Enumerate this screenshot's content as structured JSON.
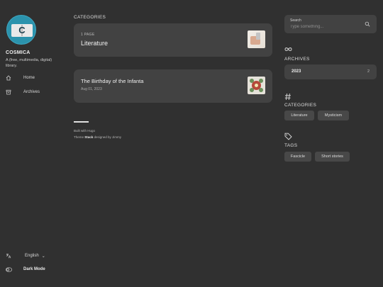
{
  "sidebar": {
    "avatar_letter": "C",
    "site_name": "COSMICA",
    "site_description": "A (free, multimedia, digital) library.",
    "menu": [
      {
        "label": "Home",
        "icon": "home-icon"
      },
      {
        "label": "Archives",
        "icon": "archive-icon"
      }
    ],
    "language": {
      "label": "English",
      "icon": "language-icon"
    },
    "dark_mode": {
      "label": "Dark Mode",
      "icon": "toggle-icon"
    }
  },
  "main": {
    "section_title": "CATEGORIES",
    "category_card": {
      "count": "1 PAGE",
      "title": "Literature"
    },
    "articles": [
      {
        "title": "The Birthday of the Infanta",
        "date": "Aug 01, 2023"
      }
    ],
    "footer": {
      "built_with": "Built with Hugo",
      "theme_prefix": "Theme ",
      "theme_name": "Stack",
      "theme_suffix": " designed by Jimmy"
    }
  },
  "right_sidebar": {
    "search": {
      "label": "Search",
      "placeholder": "Type something..."
    },
    "archives": {
      "title": "ARCHIVES",
      "items": [
        {
          "year": "2023",
          "count": "2"
        }
      ]
    },
    "categories": {
      "title": "CATEGORIES",
      "items": [
        "Literature",
        "Mysticism"
      ]
    },
    "tags": {
      "title": "TAGS",
      "items": [
        "Fascicle",
        "Short stories"
      ]
    }
  },
  "colors": {
    "background": "#303030",
    "card": "#424242",
    "avatar": "#2b93ad"
  }
}
